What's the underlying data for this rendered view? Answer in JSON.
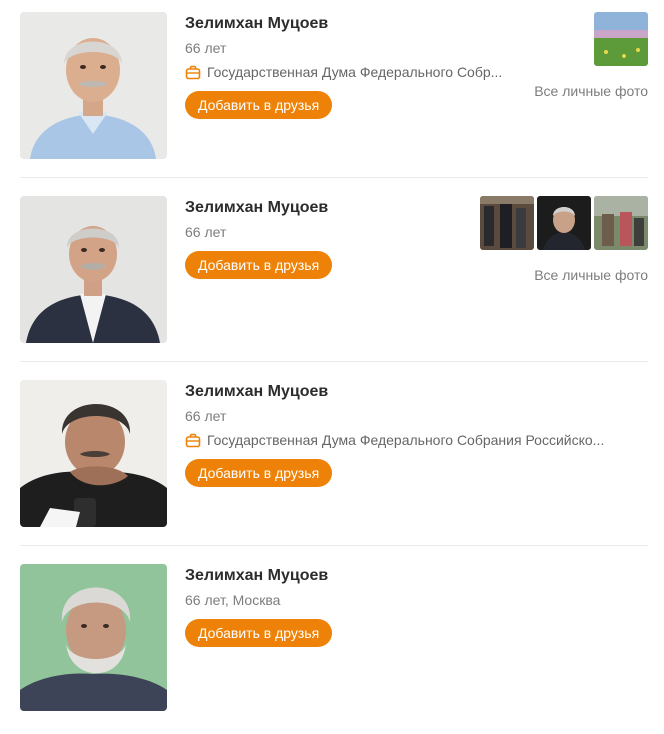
{
  "colors": {
    "accent": "#ee8208",
    "text": "#2c2c2c",
    "muted": "#7d7d7d",
    "divider": "#ebebeb"
  },
  "results": [
    {
      "name": "Зелимхан Муцоев",
      "meta": "66 лет",
      "work": "Государственная Дума Федерального Собр...",
      "add_button": "Добавить в друзья",
      "photos_link": "Все личные фото"
    },
    {
      "name": "Зелимхан Муцоев",
      "meta": "66 лет",
      "add_button": "Добавить в друзья",
      "photos_link": "Все личные фото"
    },
    {
      "name": "Зелимхан Муцоев",
      "meta": "66 лет",
      "work": "Государственная Дума Федерального Собрания Российско...",
      "add_button": "Добавить в друзья"
    },
    {
      "name": "Зелимхан Муцоев",
      "meta": "66 лет, Москва",
      "add_button": "Добавить в друзья"
    }
  ]
}
